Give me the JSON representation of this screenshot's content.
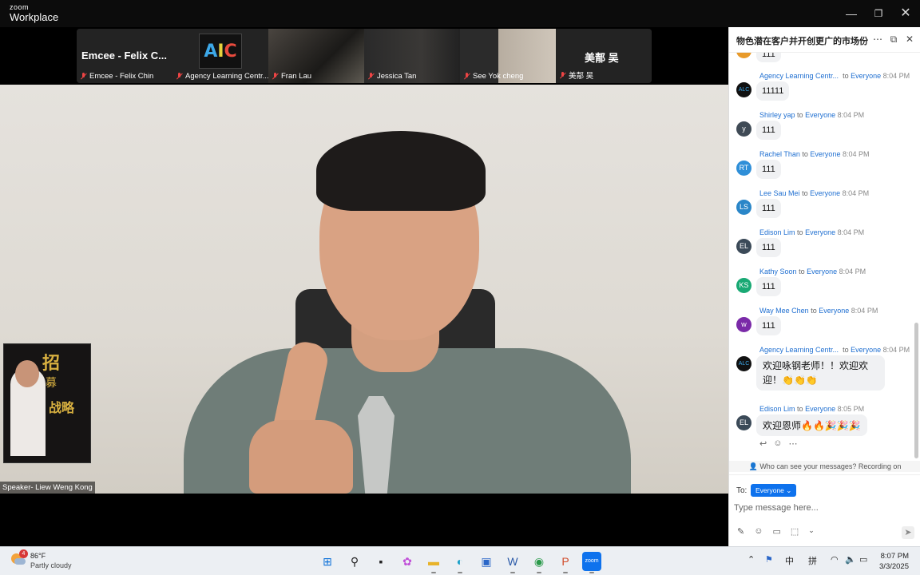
{
  "window": {
    "brand_top": "zoom",
    "brand_bottom": "Workplace",
    "min_icon": "minimize-icon",
    "restore_icon": "restore-icon",
    "close_icon": "close-icon"
  },
  "participants": [
    {
      "display": "Emcee - Felix C...",
      "name": "Emcee - Felix Chin"
    },
    {
      "display": "",
      "name": "Agency Learning Centr..."
    },
    {
      "display": "",
      "name": "Fran Lau"
    },
    {
      "display": "",
      "name": "Jessica Tan"
    },
    {
      "display": "",
      "name": "See Yok cheng"
    },
    {
      "display": "美郬 吴",
      "name": "美郬 吴"
    }
  ],
  "speaker": {
    "label": "Speaker- Liew Weng Kong"
  },
  "book_cover": {
    "t1": "招",
    "t2": "募",
    "t3": "战略"
  },
  "chat": {
    "title": "物色潜在客户并开创更广的市场份...",
    "partial_top": "111",
    "messages": [
      {
        "sender": "Agency Learning Centr...",
        "to": "to",
        "recipient": "Everyone",
        "time": "8:04 PM",
        "text": "11111",
        "avatar": "ALC",
        "color": "#111111"
      },
      {
        "sender": "Shirley yap",
        "to": "to",
        "recipient": "Everyone",
        "time": "8:04 PM",
        "text": "111",
        "avatar": "y",
        "color": "#3f4a55"
      },
      {
        "sender": "Rachel Than",
        "to": "to",
        "recipient": "Everyone",
        "time": "8:04 PM",
        "text": "111",
        "avatar": "RT",
        "color": "#2f8fd8"
      },
      {
        "sender": "Lee Sau Mei",
        "to": "to",
        "recipient": "Everyone",
        "time": "8:04 PM",
        "text": "111",
        "avatar": "LS",
        "color": "#2a86c8"
      },
      {
        "sender": "Edison Lim",
        "to": "to",
        "recipient": "Everyone",
        "time": "8:04 PM",
        "text": "111",
        "avatar": "EL",
        "color": "#3b4a58"
      },
      {
        "sender": "Kathy Soon",
        "to": "to",
        "recipient": "Everyone",
        "time": "8:04 PM",
        "text": "111",
        "avatar": "KS",
        "color": "#19a974"
      },
      {
        "sender": "Way Mee Chen",
        "to": "to",
        "recipient": "Everyone",
        "time": "8:04 PM",
        "text": "111",
        "avatar": "w",
        "color": "#7a2aa8"
      },
      {
        "sender": "Agency Learning Centr...",
        "to": "to",
        "recipient": "Everyone",
        "time": "8:04 PM",
        "text": "欢迎咏钢老师！！欢迎欢",
        "text2": "迎！👏👏👏",
        "avatar": "ALC",
        "color": "#111111"
      },
      {
        "sender": "Edison Lim",
        "to": "to",
        "recipient": "Everyone",
        "time": "8:05 PM",
        "text": "欢迎恩师🔥🔥🎉🎉🎉",
        "avatar": "EL",
        "color": "#3b4a58"
      }
    ],
    "notice": "Who can see your messages? Recording on",
    "to_label": "To:",
    "to_value": "Everyone",
    "input_placeholder": "Type message here...",
    "icons": [
      "reply-icon",
      "emoji-reaction-icon",
      "more-icon",
      "format-icon",
      "emoji-icon",
      "file-icon",
      "screenshot-icon",
      "send-icon"
    ]
  },
  "taskbar": {
    "badge": "4",
    "temp": "86°F",
    "condition": "Partly cloudy",
    "ime": "中",
    "ime2": "拼",
    "time": "8:07 PM",
    "date": "3/3/2025"
  }
}
